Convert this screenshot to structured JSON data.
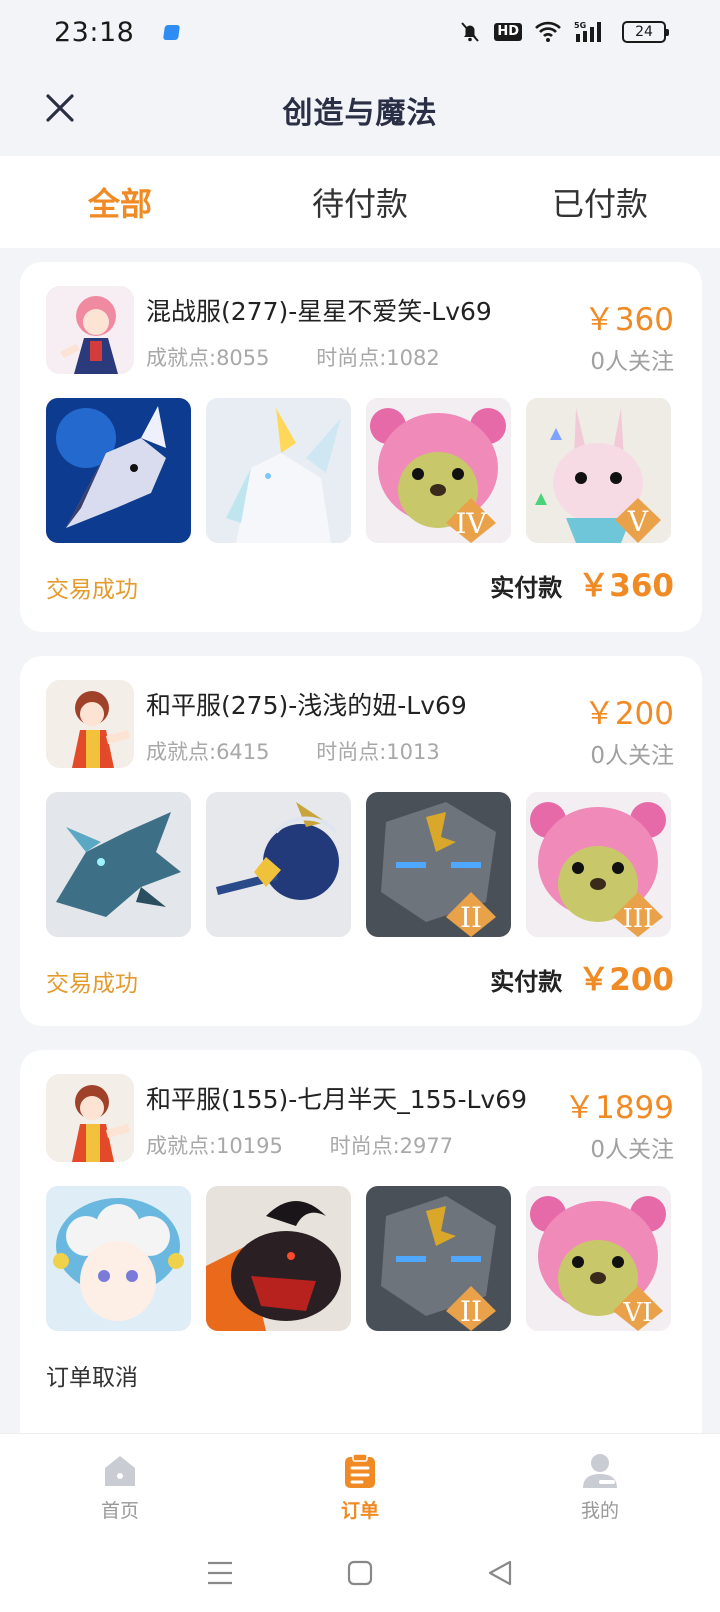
{
  "status_bar": {
    "time": "23:18",
    "battery": "24"
  },
  "header": {
    "title": "创造与魔法"
  },
  "tabs": [
    {
      "label": "全部",
      "active": true
    },
    {
      "label": "待付款",
      "active": false
    },
    {
      "label": "已付款",
      "active": false
    }
  ],
  "orders": [
    {
      "title": "混战服(277)-星星不爱笑-Lv69",
      "achievement": "成就点:8055",
      "fashion": "时尚点:1082",
      "price": "￥360",
      "followers": "0人关注",
      "thumbnails": [
        "blue-wolf-mount",
        "white-fox-mount",
        "pink-bear-IV",
        "rabbit-V"
      ],
      "status": "交易成功",
      "paid_label": "实付款",
      "paid_value": "￥360"
    },
    {
      "title": "和平服(275)-浅浅的妞-Lv69",
      "achievement": "成就点:6415",
      "fashion": "时尚点:1013",
      "price": "￥200",
      "followers": "0人关注",
      "thumbnails": [
        "ice-dragon",
        "magic-staff",
        "stone-golem-II",
        "pink-bear-III"
      ],
      "status": "交易成功",
      "paid_label": "实付款",
      "paid_value": "￥200"
    },
    {
      "title": "和平服(155)-七月半天_155-Lv69",
      "achievement": "成就点:10195",
      "fashion": "时尚点:2977",
      "price": "￥1899",
      "followers": "0人关注",
      "thumbnails": [
        "cloud-girl",
        "black-ram",
        "stone-golem-II",
        "pink-bear-VI"
      ],
      "status": "订单取消"
    }
  ],
  "bottom_nav": [
    {
      "label": "首页",
      "icon": "home-icon",
      "active": false
    },
    {
      "label": "订单",
      "icon": "order-icon",
      "active": true
    },
    {
      "label": "我的",
      "icon": "profile-icon",
      "active": false
    }
  ],
  "colors": {
    "accent": "#f08a24",
    "success": "#e49b2d",
    "title": "#2a2f45"
  }
}
